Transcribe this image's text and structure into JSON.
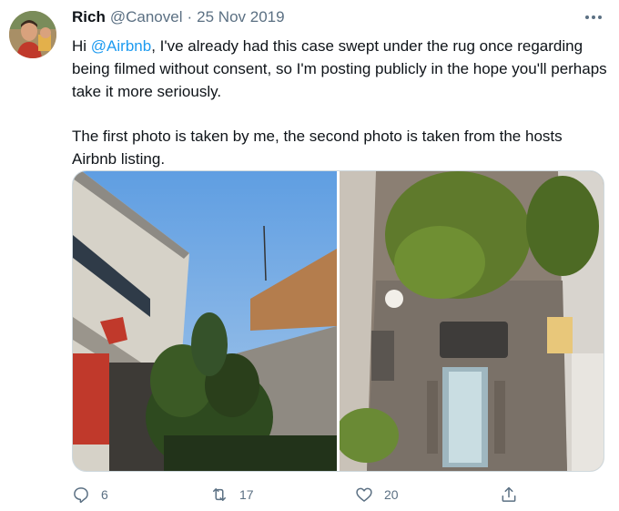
{
  "tweet": {
    "author_name": "Rich",
    "handle": "@Canovel",
    "separator": "·",
    "date": "25 Nov 2019",
    "more_label": "•••",
    "line1_prefix": "Hi ",
    "mention": "@Airbnb",
    "line1_rest": ", I've already had this case swept under the rug once regarding being filmed without consent, so I'm posting publicly in the hope you'll perhaps take it more seriously.",
    "paragraph2": "The first photo is taken by me, the second photo is taken from the hosts Airbnb listing."
  },
  "actions": {
    "reply_count": "6",
    "retweet_count": "17",
    "like_count": "20"
  },
  "icons": {
    "reply": "reply-icon",
    "retweet": "retweet-icon",
    "like": "heart-icon",
    "share": "share-icon",
    "more": "more-icon"
  },
  "colors": {
    "accent": "#1d9bf0",
    "secondary_text": "#5b7083",
    "border": "#cfd9de"
  }
}
